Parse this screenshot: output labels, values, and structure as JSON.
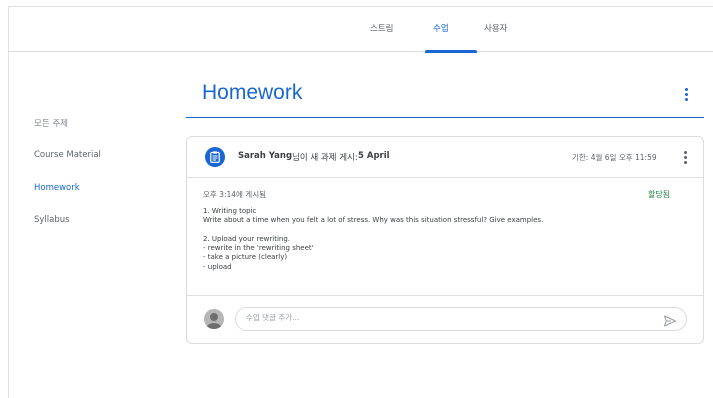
{
  "tabs": [
    {
      "label": "스트림"
    },
    {
      "label": "수업"
    },
    {
      "label": "사용자"
    }
  ],
  "sidebar": {
    "items": [
      {
        "label": "모든 주제"
      },
      {
        "label": "Course Material"
      },
      {
        "label": "Homework"
      },
      {
        "label": "Syllabus"
      }
    ]
  },
  "section": {
    "title": "Homework"
  },
  "post": {
    "author": "Sarah Yang",
    "action": "님이 새 과제 게시: ",
    "title": "5 April",
    "due": "기한: 4월 6일 오후 11:59",
    "posted": "오후 3:14에 게시됨",
    "status": "할당됨",
    "body": [
      "1. Writing topic",
      "Write about a time when you felt a lot of stress. Why was this situation stressful? Give examples.",
      "",
      "2. Upload your rewriting.",
      "- rewrite in the 'rewriting sheet'",
      "- take a picture (clearly)",
      "- upload"
    ]
  },
  "comment": {
    "placeholder": "수업 댓글 추가..."
  },
  "colors": {
    "accent": "#1967d2",
    "status": "#188038"
  }
}
